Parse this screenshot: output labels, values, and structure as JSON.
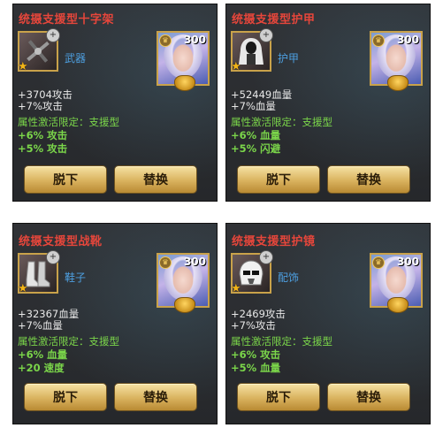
{
  "panels": [
    {
      "title": "统摄支援型十字架",
      "slot": "武器",
      "item_icon": "crossbow-icon",
      "hero_level": "300",
      "stats": [
        "+3704攻击",
        "+7%攻击"
      ],
      "bonus_title": "属性激活限定：支援型",
      "bonuses": [
        "+6% 攻击",
        "+5% 攻击"
      ],
      "unequip_label": "脱下",
      "replace_label": "替换"
    },
    {
      "title": "统摄支援型护甲",
      "slot": "护甲",
      "item_icon": "hooded-armor-icon",
      "hero_level": "300",
      "stats": [
        "+52449血量",
        "+7%血量"
      ],
      "bonus_title": "属性激活限定：支援型",
      "bonuses": [
        "+6% 血量",
        "+5% 闪避"
      ],
      "unequip_label": "脱下",
      "replace_label": "替换"
    },
    {
      "title": "统摄支援型战靴",
      "slot": "鞋子",
      "item_icon": "boots-icon",
      "hero_level": "300",
      "stats": [
        "+32367血量",
        "+7%血量"
      ],
      "bonus_title": "属性激活限定：支援型",
      "bonuses": [
        "+6% 血量",
        "+20 速度"
      ],
      "unequip_label": "脱下",
      "replace_label": "替换"
    },
    {
      "title": "统摄支援型护镜",
      "slot": "配饰",
      "item_icon": "helmet-icon",
      "hero_level": "300",
      "stats": [
        "+2469攻击",
        "+7%攻击"
      ],
      "bonus_title": "属性激活限定：支援型",
      "bonuses": [
        "+6% 攻击",
        "+5% 血量"
      ],
      "unequip_label": "脱下",
      "replace_label": "替换"
    }
  ],
  "colors": {
    "title": "#e6463b",
    "slot": "#4d9fe0",
    "bonus": "#7bd64a",
    "frame": "#c9a24a"
  }
}
